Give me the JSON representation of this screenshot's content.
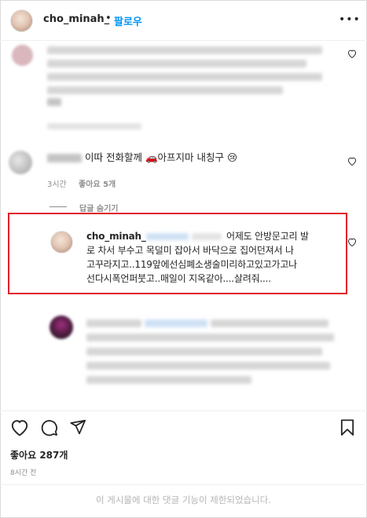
{
  "header": {
    "username": "cho_minah_",
    "separator": "•",
    "follow_label": "팔로우",
    "more_label": "•••"
  },
  "comments": {
    "second": {
      "text": "이따 전화할께 🚗아프지마 내칭구 😢",
      "time": "3시간",
      "likes": "좋아요 5개"
    }
  },
  "replies": {
    "hide_label": "답글 숨기기",
    "highlighted": {
      "username": "cho_minah_",
      "line1": "어제도 안방문고리 발",
      "line2": "로 차서 부수고 목덜미 잡아서 바닥으로 집어던져서 나",
      "line3": "고꾸라지고..119앞에선심폐소생술미리하고있고가고나",
      "line4": "선다시폭언퍼붓고..매일이 지옥같아....살려줘...."
    }
  },
  "post": {
    "likes_label": "좋아요",
    "likes_count": "287개",
    "time_ago": "8시간 전",
    "restricted_notice": "이 게시물에 대한 댓글 기능이 제한되었습니다."
  },
  "colors": {
    "accent": "#0095f6",
    "highlight_box": "#e0222a",
    "muted": "#8e8e8e"
  }
}
